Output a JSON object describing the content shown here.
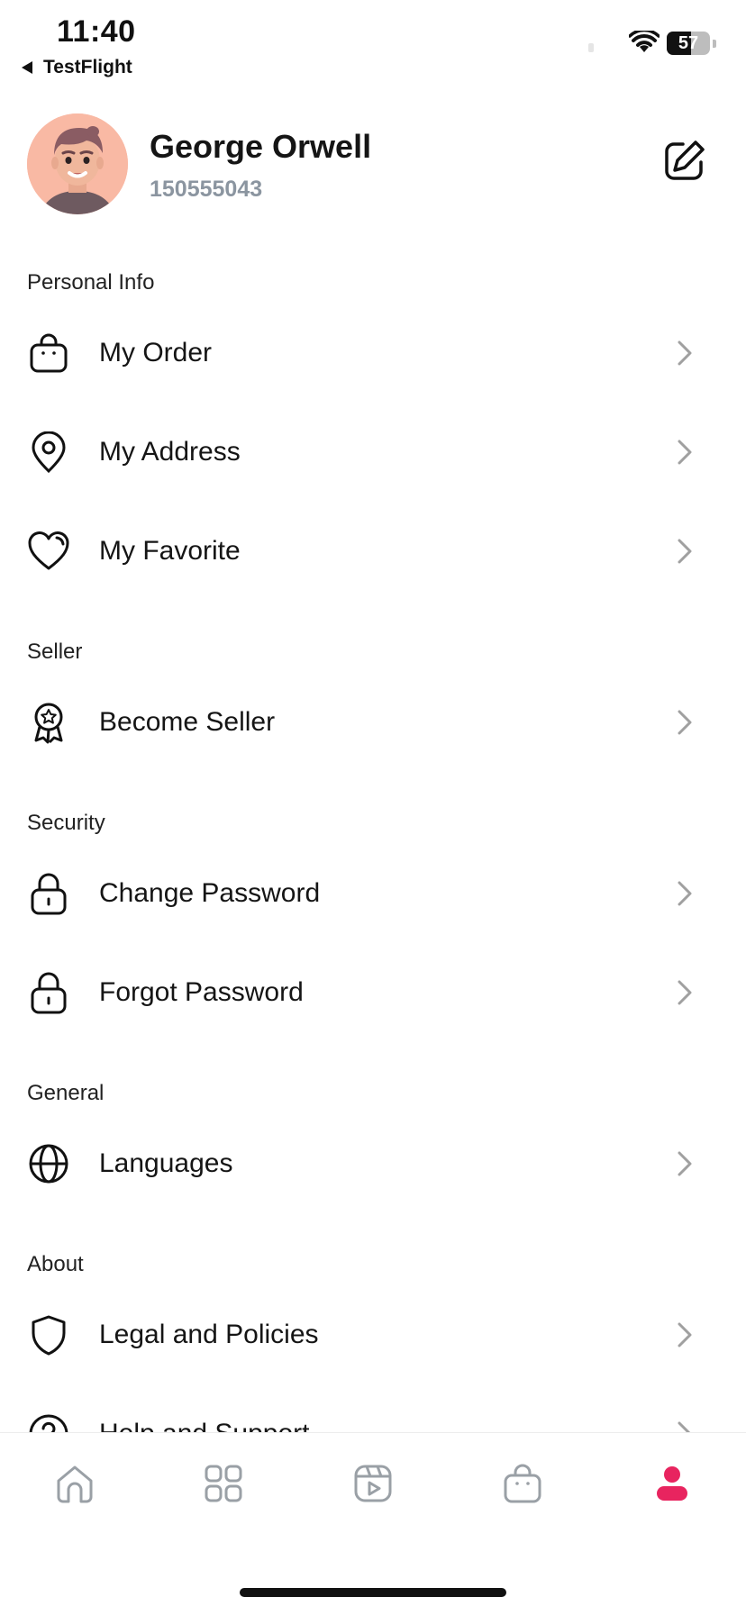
{
  "status_bar": {
    "time": "11:40",
    "back_label": "TestFlight",
    "battery_level": "57"
  },
  "profile": {
    "name": "George Orwell",
    "id": "150555043"
  },
  "sections": {
    "personal_info": {
      "title": "Personal Info",
      "items": [
        {
          "label": "My Order",
          "icon": "shopping-bag-icon"
        },
        {
          "label": "My Address",
          "icon": "location-pin-icon"
        },
        {
          "label": "My Favorite",
          "icon": "heart-icon"
        }
      ]
    },
    "seller": {
      "title": "Seller",
      "items": [
        {
          "label": "Become Seller",
          "icon": "badge-icon"
        }
      ]
    },
    "security": {
      "title": "Security",
      "items": [
        {
          "label": "Change Password",
          "icon": "lock-icon"
        },
        {
          "label": "Forgot Password",
          "icon": "lock-icon"
        }
      ]
    },
    "general": {
      "title": "General",
      "items": [
        {
          "label": "Languages",
          "icon": "globe-icon"
        }
      ]
    },
    "about": {
      "title": "About",
      "items": [
        {
          "label": "Legal and Policies",
          "icon": "shield-icon"
        },
        {
          "label": "Help and Support",
          "icon": "help-circle-icon"
        }
      ]
    }
  },
  "tab_bar": {
    "tabs": [
      {
        "name": "home",
        "icon": "home-icon"
      },
      {
        "name": "categories",
        "icon": "grid-icon"
      },
      {
        "name": "videos",
        "icon": "video-icon"
      },
      {
        "name": "cart",
        "icon": "bag-icon"
      },
      {
        "name": "profile",
        "icon": "user-icon",
        "active": true
      }
    ],
    "active_color": "#e8245f",
    "inactive_color": "#9aa0a6"
  }
}
